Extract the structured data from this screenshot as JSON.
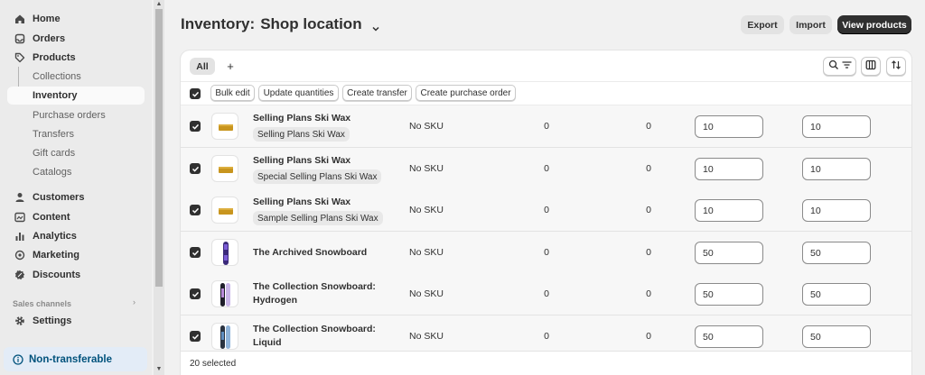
{
  "sidebar": {
    "items": [
      {
        "label": "Home",
        "icon": "home-icon"
      },
      {
        "label": "Orders",
        "icon": "orders-icon"
      },
      {
        "label": "Products",
        "icon": "tag-icon"
      }
    ],
    "product_sub": [
      "Collections",
      "Inventory",
      "Purchase orders",
      "Transfers",
      "Gift cards",
      "Catalogs"
    ],
    "active_sub": "Inventory",
    "items2": [
      {
        "label": "Customers",
        "icon": "person-icon"
      },
      {
        "label": "Content",
        "icon": "content-icon"
      },
      {
        "label": "Analytics",
        "icon": "analytics-icon"
      },
      {
        "label": "Marketing",
        "icon": "target-icon"
      },
      {
        "label": "Discounts",
        "icon": "discount-icon"
      }
    ],
    "sales_channels": "Sales channels",
    "settings": "Settings",
    "non_transferable": "Non-transferable"
  },
  "header": {
    "title": "Inventory:",
    "location": "Shop location",
    "export": "Export",
    "import": "Import",
    "view_products": "View products"
  },
  "tabs": {
    "all": "All",
    "add": "+"
  },
  "bulk": {
    "bulk_edit": "Bulk edit",
    "update_quantities": "Update quantities",
    "create_transfer": "Create transfer",
    "create_purchase_order": "Create purchase order"
  },
  "rows": [
    {
      "name": "Selling Plans Ski Wax",
      "variant": "Selling Plans Ski Wax",
      "sku": "No SKU",
      "unavailable": "0",
      "committed": "0",
      "available": "10",
      "on_hand": "10",
      "thumb": "wax"
    },
    {
      "name": "Selling Plans Ski Wax",
      "variant": "Special Selling Plans Ski Wax",
      "sku": "No SKU",
      "unavailable": "0",
      "committed": "0",
      "available": "10",
      "on_hand": "10",
      "thumb": "wax"
    },
    {
      "name": "Selling Plans Ski Wax",
      "variant": "Sample Selling Plans Ski Wax",
      "sku": "No SKU",
      "unavailable": "0",
      "committed": "0",
      "available": "10",
      "on_hand": "10",
      "thumb": "wax"
    },
    {
      "name": "The Archived Snowboard",
      "variant": "",
      "sku": "No SKU",
      "unavailable": "0",
      "committed": "0",
      "available": "50",
      "on_hand": "50",
      "thumb": "board-purple"
    },
    {
      "name": "The Collection Snowboard: Hydrogen",
      "variant": "",
      "sku": "No SKU",
      "unavailable": "0",
      "committed": "0",
      "available": "50",
      "on_hand": "50",
      "thumb": "board-hydrogen"
    },
    {
      "name": "The Collection Snowboard: Liquid",
      "variant": "",
      "sku": "No SKU",
      "unavailable": "0",
      "committed": "0",
      "available": "50",
      "on_hand": "50",
      "thumb": "board-liquid"
    }
  ],
  "footer": {
    "selected": "20 selected"
  },
  "colors": {
    "primary_button": "#303030",
    "nontransferable_bg": "#e3ecf7",
    "nontransferable_text": "#00527c",
    "checkbox": "#303030"
  }
}
